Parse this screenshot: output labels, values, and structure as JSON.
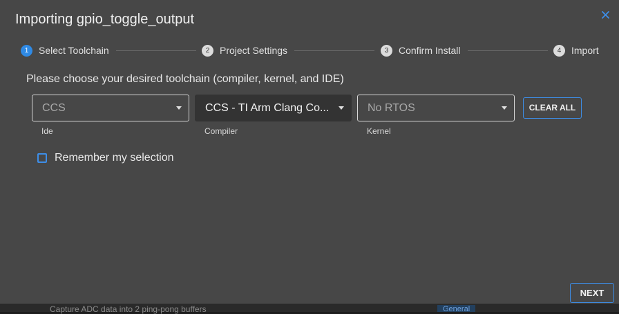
{
  "background": {
    "row_text": "Capture ADC data into 2 ping-pong buffers",
    "row_badge": "General"
  },
  "dialog": {
    "title": "Importing gpio_toggle_output",
    "close_icon": "close-icon",
    "steps": [
      {
        "number": "1",
        "label": "Select Toolchain",
        "active": true
      },
      {
        "number": "2",
        "label": "Project Settings",
        "active": false
      },
      {
        "number": "3",
        "label": "Confirm Install",
        "active": false
      },
      {
        "number": "4",
        "label": "Import",
        "active": false
      }
    ],
    "prompt": "Please choose your desired toolchain (compiler, kernel, and IDE)",
    "selects": [
      {
        "value": "CCS",
        "helper": "Ide"
      },
      {
        "value": "CCS - TI Arm Clang Co...",
        "helper": "Compiler"
      },
      {
        "value": "No RTOS",
        "helper": "Kernel"
      }
    ],
    "clear_all_label": "CLEAR ALL",
    "remember_label": "Remember my selection",
    "remember_checked": false,
    "next_label": "NEXT"
  },
  "colors": {
    "dialog_bg": "#474747",
    "accent": "#3d8ee8",
    "active_step": "#2f8ae5"
  }
}
